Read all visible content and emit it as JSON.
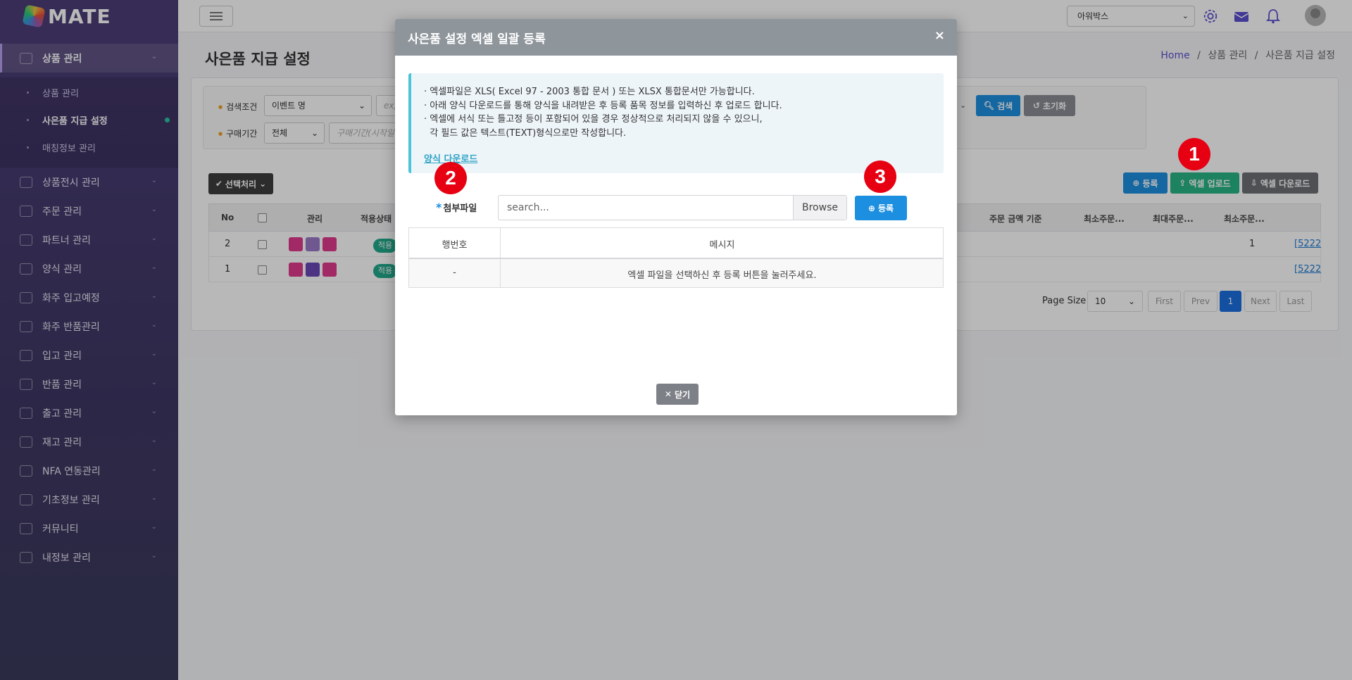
{
  "app": {
    "logo_text": "MATE"
  },
  "sidebar": {
    "items": [
      {
        "label": "상품 관리",
        "icon": "box-icon"
      },
      {
        "label": "상품전시 관리",
        "icon": "store-icon"
      },
      {
        "label": "주문 관리",
        "icon": "cart-icon"
      },
      {
        "label": "파트너 관리",
        "icon": "handshake-icon"
      },
      {
        "label": "양식 관리",
        "icon": "document-icon"
      },
      {
        "label": "화주 입고예정",
        "icon": "inbound-icon"
      },
      {
        "label": "화주 반품관리",
        "icon": "return-icon"
      },
      {
        "label": "입고 관리",
        "icon": "forklift-icon"
      },
      {
        "label": "반품 관리",
        "icon": "logout-icon"
      },
      {
        "label": "출고 관리",
        "icon": "truck-icon"
      },
      {
        "label": "재고 관리",
        "icon": "stock-icon"
      },
      {
        "label": "NFA 연동관리",
        "icon": "link-icon"
      },
      {
        "label": "기초정보 관리",
        "icon": "wrench-icon"
      },
      {
        "label": "커뮤니티",
        "icon": "chat-icon"
      },
      {
        "label": "내정보 관리",
        "icon": "info-icon"
      }
    ],
    "sub_items": [
      {
        "label": "상품 관리"
      },
      {
        "label": "사은품 지급 설정"
      },
      {
        "label": "매칭정보 관리"
      }
    ]
  },
  "topbar": {
    "company_select": "아워박스"
  },
  "page": {
    "title": "사은품 지급 설정",
    "breadcrumb": {
      "home": "Home",
      "sep1": "/",
      "level1": "상품 관리",
      "sep2": "/",
      "level2": "사은품 지급 설정"
    }
  },
  "filter": {
    "condition_label": "검색조건",
    "condition_value": "이벤트 명",
    "condition_input_placeholder": "ex)",
    "period_label": "구매기간",
    "period_value": "전체",
    "period_input_placeholder": "구매기간(시작일",
    "search_btn": "검색",
    "reset_btn": "초기화"
  },
  "actions": {
    "bulk_btn": "선택처리",
    "register_btn": "등록",
    "excel_upload_btn": "엑셀 업로드",
    "excel_download_btn": "엑셀 다운로드"
  },
  "table": {
    "columns": [
      "No",
      "관리",
      "적용상태",
      "주문 금액 기준",
      "최소주문...",
      "최대주문...",
      "최소주문..."
    ],
    "rows": [
      {
        "no": "2",
        "status": "적용",
        "min_qty": "1",
        "link": "[5222"
      },
      {
        "no": "1",
        "status": "적용",
        "min_qty": "",
        "link": "[5222"
      }
    ]
  },
  "pagination": {
    "page_size_label": "Page Size",
    "page_size_value": "10",
    "first": "First",
    "prev": "Prev",
    "current": "1",
    "next": "Next",
    "last": "Last"
  },
  "modal": {
    "title": "사은품 설정 엑셀 일괄 등록",
    "close_x": "×",
    "notice": [
      "· 엑셀파일은 XLS( Excel 97 - 2003 통합 문서 ) 또는 XLSX 통합문서만 가능합니다.",
      "· 아래 양식 다운로드를 통해 양식을 내려받은 후 등록 품목 정보를 입력하신 후 업로드 합니다.",
      "· 엑셀에 서식 또는 틀고정 등이 포함되어 있을 경우 정상적으로 처리되지 않을 수 있으니,",
      "  각 필드 값은 텍스트(TEXT)형식으로만 작성합니다."
    ],
    "template_download": "양식 다운로드",
    "file_label_required": "*",
    "file_label": "첨부파일",
    "file_placeholder": "search...",
    "browse_btn": "Browse",
    "register_btn": "등록",
    "result_columns": [
      "행번호",
      "메시지"
    ],
    "result_rows": [
      {
        "row": "-",
        "message": "엑셀 파일을 선택하신 후 등록 버튼을 눌러주세요."
      }
    ],
    "close_btn": "닫기"
  },
  "callouts": [
    "1",
    "2",
    "3"
  ],
  "colors": {
    "sidebar": "#4c3e78",
    "primary_blue": "#1d8fe0",
    "green": "#28b584",
    "modal_header": "#8e959b",
    "callout_red": "#e60012"
  }
}
